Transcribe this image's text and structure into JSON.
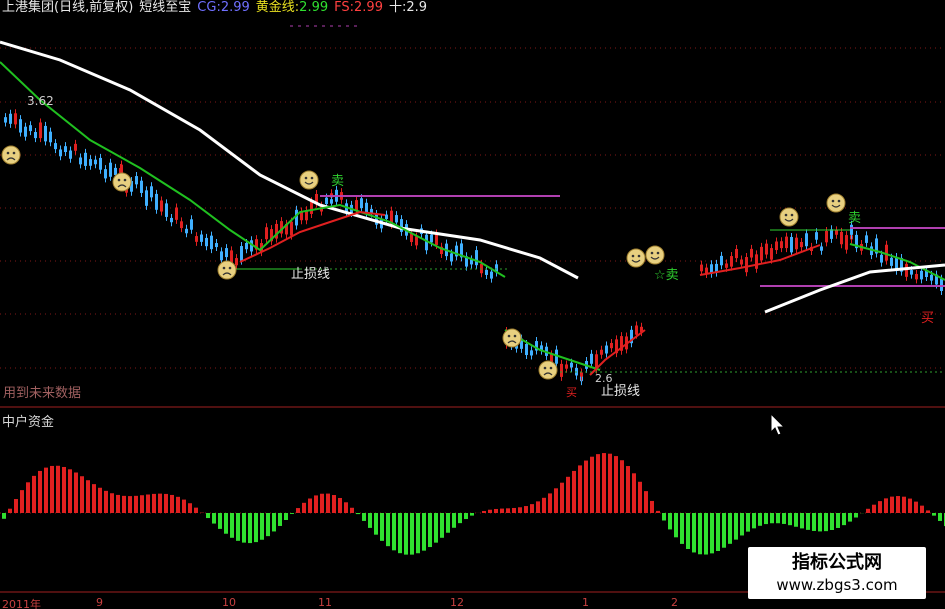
{
  "header": {
    "title": "上港集团(日线,前复权)",
    "indicator_name": "短线至宝",
    "cg_label": "CG:",
    "cg_value": "2.99",
    "gold_label": "黄金线:",
    "gold_value": "2.99",
    "fs_label": "FS:",
    "fs_value": "2.99",
    "ten_label": "十:",
    "ten_value": "2.9"
  },
  "annotations": {
    "price_high": "3.62",
    "stop_loss_1": "止损线",
    "stop_loss_2": "止损线",
    "low_price": "2.6",
    "future_data_note": "用到未来数据",
    "sell_1": "卖",
    "sell_2": "☆卖",
    "sell_3": "卖",
    "buy_1": "买",
    "buy_2": "买"
  },
  "subchart": {
    "title": "中户资金"
  },
  "dates": [
    "2011年",
    "9",
    "10",
    "11",
    "12",
    "1",
    "2"
  ],
  "watermark": {
    "line1": "指标公式网",
    "line2": "www.zbgs3.com"
  },
  "colors": {
    "background": "#000000",
    "up": "#e02020",
    "down": "#40b0ff",
    "ma_fast": "#20c020",
    "ma_slow": "#ffffff",
    "flow_pos": "#e02020",
    "flow_neg": "#30e030"
  },
  "icons": [
    "smile-face-icon",
    "sad-face-icon",
    "mouse-pointer-icon"
  ]
}
